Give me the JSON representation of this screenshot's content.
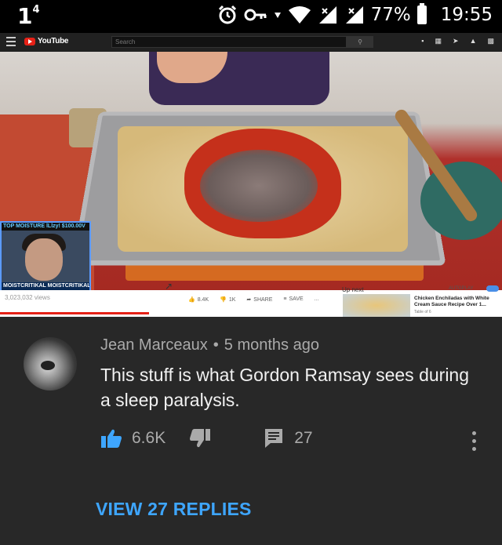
{
  "status_bar": {
    "notification": "1",
    "notification_sup": "4",
    "battery": "77%",
    "time": "19:55",
    "icons": [
      "alarm-icon",
      "key-icon",
      "wifi-icon",
      "signal-icon",
      "battery-icon"
    ]
  },
  "embedded_screenshot": {
    "yt_header": {
      "logo": "YouTube",
      "search_placeholder": "Search"
    },
    "stream_overlay": {
      "top_text": "TOP MOISTURE lLlzy! $100.00V",
      "bottom_text": "MOISTCRITIKAL  MOISTCRITIKAL"
    },
    "views": "3,023,032 views",
    "actions": {
      "likes": "8.4K",
      "dislikes": "1K",
      "share": "SHARE",
      "save": "SAVE",
      "more": "..."
    },
    "up_next": "Up next",
    "autoplay": "AUTOPLAY",
    "recommended": {
      "title": "Chicken Enchiladas with White Cream Sauce Recipe Over 1...",
      "channel": "Table of 6"
    }
  },
  "comment": {
    "author": "Jean Marceaux",
    "time": "5 months ago",
    "separator": "•",
    "text": "This stuff is what Gordon Ramsay sees during a sleep paralysis.",
    "likes": "6.6K",
    "replies_count": "27",
    "view_replies": "VIEW 27 REPLIES"
  },
  "colors": {
    "accent": "#3ea6ff",
    "background": "#282828",
    "text": "#f1f1f1",
    "muted": "#aaaaaa"
  }
}
